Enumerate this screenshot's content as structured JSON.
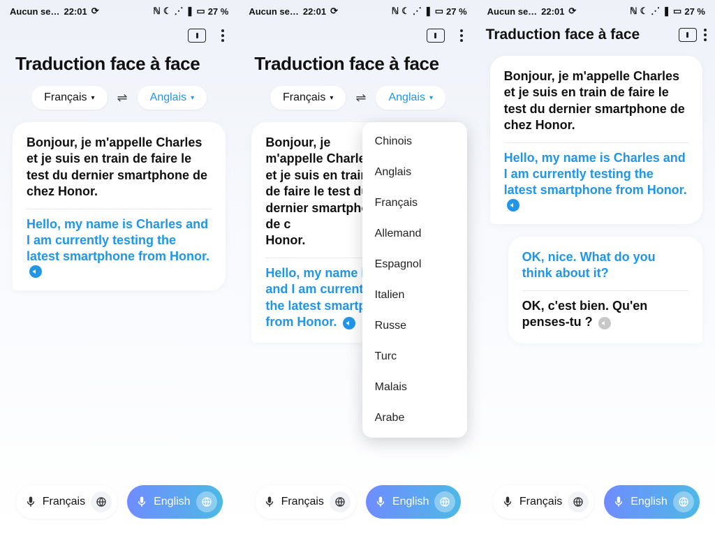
{
  "status": {
    "carrier": "Aucun se…",
    "time": "22:01",
    "battery": "27 %"
  },
  "title": "Traduction face à face",
  "languages": {
    "source": "Français",
    "target": "Anglais",
    "options": [
      "Chinois",
      "Anglais",
      "Français",
      "Allemand",
      "Espagnol",
      "Italien",
      "Russe",
      "Turc",
      "Malais",
      "Arabe"
    ]
  },
  "message1": {
    "source_text": "Bonjour, je m'appelle Charles et je suis en train de faire le test du dernier smartphone de chez Honor.",
    "translated_text": "Hello, my name is Charles and I am currently testing the latest smartphone from Honor."
  },
  "message2_partial": {
    "source_text": "Bonjour, je m'appelle Charles et je suis en train de faire le test du dernier smartphone de c Honor.",
    "translated_prefix": "Hello, my name is",
    "translated_line2": "and I am currentl",
    "translated_line3": "the latest smartp",
    "translated_line4": "from Honor."
  },
  "reply": {
    "target_text": "OK, nice. What do you think about it?",
    "source_text": "OK, c'est bien. Qu'en penses-tu ?"
  },
  "bottom": {
    "left_label": "Français",
    "right_label": "English"
  }
}
